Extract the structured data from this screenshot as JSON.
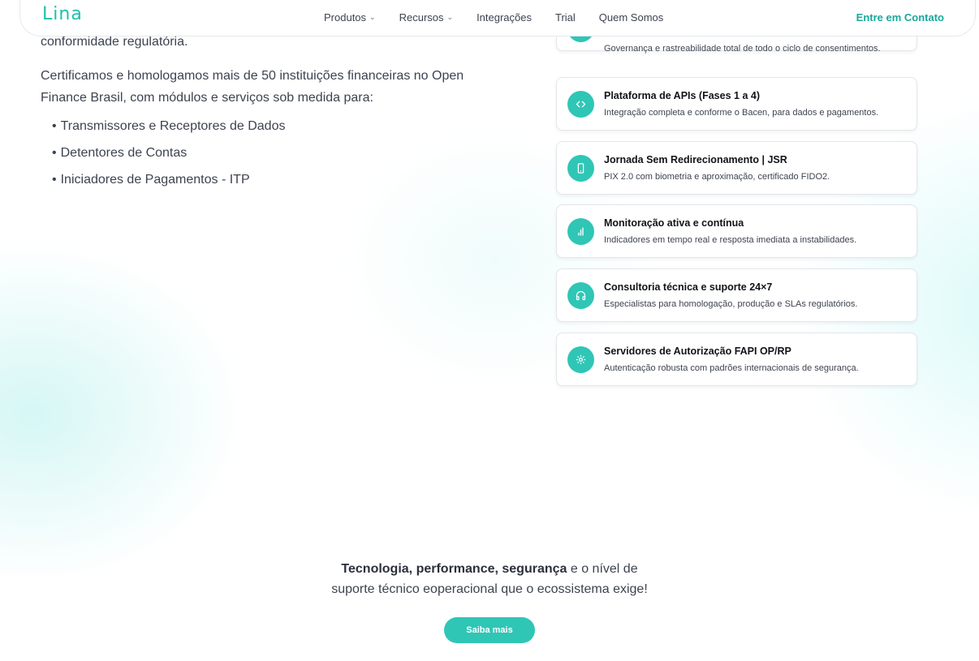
{
  "nav": {
    "logo": "Lina",
    "links": [
      {
        "label": "Produtos",
        "dropdown": true
      },
      {
        "label": "Recursos",
        "dropdown": true
      },
      {
        "label": "Integrações",
        "dropdown": false
      },
      {
        "label": "Trial",
        "dropdown": false
      },
      {
        "label": "Quem Somos",
        "dropdown": false
      }
    ],
    "chevron": "⌄",
    "cta": "Entre em Contato"
  },
  "left": {
    "regulatory_text": "conformidade regulatória.",
    "cert_text": "Certificamos e homologamos mais de 50 instituições financeiras no Open Finance Brasil, com módulos e serviços sob medida para:",
    "bullet_mark": "•",
    "bullets": [
      "Transmissores e Receptores de Dados",
      "Detentores de Contas",
      "Iniciadores de Pagamentos - ITP"
    ]
  },
  "cards": [
    {
      "title": "",
      "desc": "Governança e rastreabilidade total de todo o ciclo de consentimentos.",
      "icon": "shield-icon"
    },
    {
      "title": "Plataforma de APIs (Fases 1 a 4)",
      "desc": "Integração completa e conforme o Bacen, para dados e pagamentos.",
      "icon": "code-icon"
    },
    {
      "title": "Jornada Sem Redirecionamento | JSR",
      "desc": "PIX 2.0 com biometria e aproximação, certificado FIDO2.",
      "icon": "smartphone-icon"
    },
    {
      "title": "Monitoração ativa e contínua",
      "desc": "Indicadores em tempo real e resposta imediata a instabilidades.",
      "icon": "bar-chart-icon"
    },
    {
      "title": "Consultoria técnica e suporte 24×7",
      "desc": "Especialistas para homologação, produção e SLAs regulatórios.",
      "icon": "headphones-icon"
    },
    {
      "title": "Servidores de Autorização FAPI OP/RP",
      "desc": "Autenticação robusta com padrões internacionais de segurança.",
      "icon": "gear-icon"
    }
  ],
  "bottom": {
    "bold1": "Tecnologia",
    "sep1": ", ",
    "bold2": "performance",
    "sep2": ", ",
    "bold3": "segurança",
    "rest1": " e o nível de",
    "line2": "suporte técnico eoperacional que o ecossistema exige!",
    "button": "Saiba mais"
  },
  "colors": {
    "accent": "#2fc6b6",
    "accent_text": "#16a99b",
    "text": "#3d4350",
    "card_border": "#e3e6ea"
  }
}
